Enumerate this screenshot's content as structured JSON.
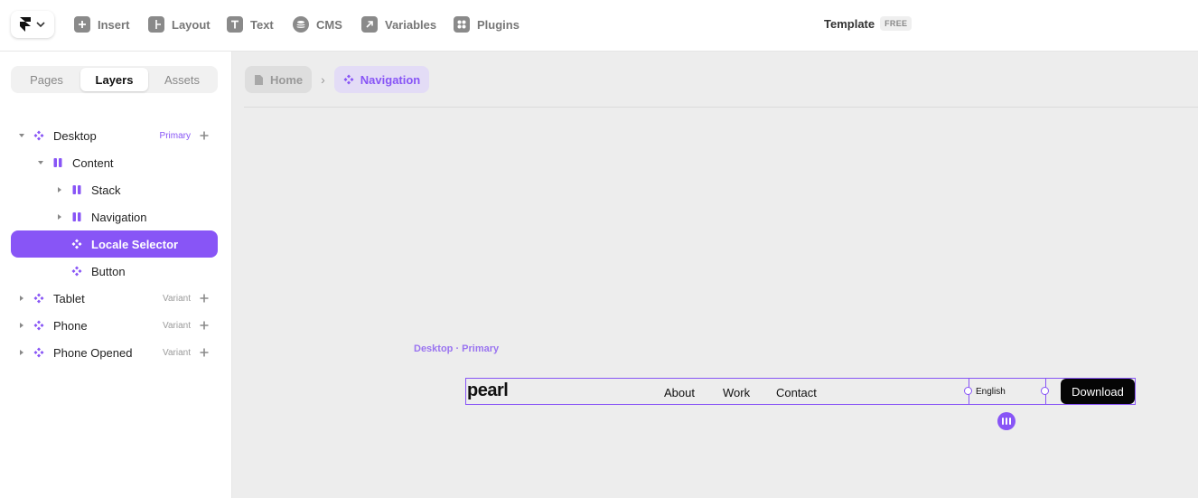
{
  "toolbar": {
    "items": [
      {
        "label": "Insert",
        "icon": "plus-square-icon"
      },
      {
        "label": "Layout",
        "icon": "layout-icon"
      },
      {
        "label": "Text",
        "icon": "text-icon"
      },
      {
        "label": "CMS",
        "icon": "database-icon"
      },
      {
        "label": "Variables",
        "icon": "arrow-up-right-icon"
      },
      {
        "label": "Plugins",
        "icon": "plugins-icon"
      }
    ],
    "title": "Template",
    "badge": "FREE"
  },
  "panel": {
    "tabs": [
      {
        "label": "Pages",
        "active": false
      },
      {
        "label": "Layers",
        "active": true
      },
      {
        "label": "Assets",
        "active": false
      }
    ],
    "layers": [
      {
        "name": "Desktop",
        "tag": "Primary",
        "icon": "component-icon",
        "depth": 0,
        "expanded": true
      },
      {
        "name": "Content",
        "tag": "",
        "icon": "stack-icon",
        "depth": 1,
        "expanded": true
      },
      {
        "name": "Stack",
        "tag": "",
        "icon": "stack-icon",
        "depth": 2,
        "expanded": false
      },
      {
        "name": "Navigation",
        "tag": "",
        "icon": "stack-icon",
        "depth": 2,
        "expanded": false
      },
      {
        "name": "Locale Selector",
        "tag": "",
        "icon": "component-icon",
        "depth": 2,
        "selected": true
      },
      {
        "name": "Button",
        "tag": "",
        "icon": "component-icon",
        "depth": 2
      },
      {
        "name": "Tablet",
        "tag": "Variant",
        "icon": "component-icon",
        "depth": 0,
        "expanded": false
      },
      {
        "name": "Phone",
        "tag": "Variant",
        "icon": "component-icon",
        "depth": 0,
        "expanded": false
      },
      {
        "name": "Phone Opened",
        "tag": "Variant",
        "icon": "component-icon",
        "depth": 0,
        "expanded": false
      }
    ]
  },
  "canvas": {
    "breadcrumb": [
      {
        "label": "Home",
        "icon": "page-icon"
      },
      {
        "label": "Navigation",
        "icon": "component-icon"
      }
    ],
    "frame_label": "Desktop · Primary",
    "site": {
      "brand": "pearl",
      "links": [
        "About",
        "Work",
        "Contact"
      ],
      "locale": "English",
      "cta": "Download"
    }
  },
  "colors": {
    "accent": "#8855f6",
    "canvas": "#ededed",
    "cta": "#050505"
  }
}
